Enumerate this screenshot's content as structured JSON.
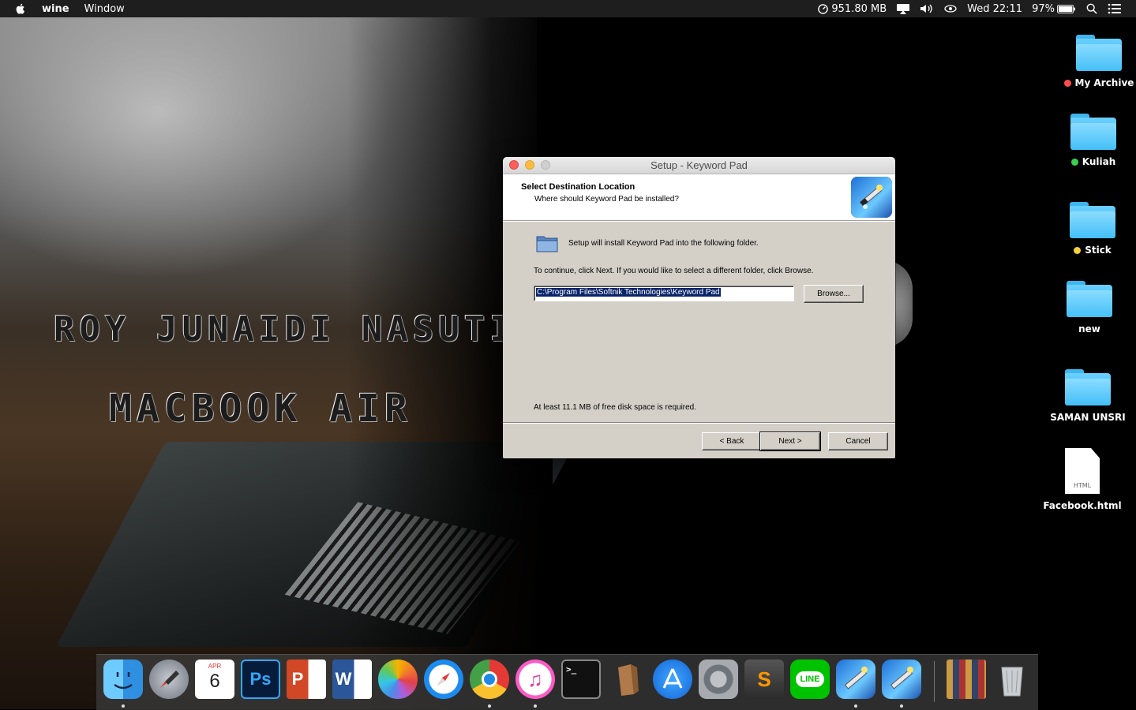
{
  "menubar": {
    "app_name": "wine",
    "menus": [
      "Window"
    ],
    "memory": "951.80 MB",
    "clock": "Wed 22:11",
    "battery": "97%"
  },
  "wallpaper": {
    "line1": "Roy Junaidi Nasution",
    "line2": "MacBook Air"
  },
  "desktop_icons": [
    {
      "label": "My Archive",
      "tag_color": "#ff4d4d"
    },
    {
      "label": "Kuliah",
      "tag_color": "#3ccf4e"
    },
    {
      "label": "Stick",
      "tag_color": "#f4d03f"
    },
    {
      "label": "new",
      "tag_color": ""
    },
    {
      "label": "SAMAN UNSRI",
      "tag_color": ""
    },
    {
      "label": "Facebook.html",
      "file_badge": "HTML"
    }
  ],
  "setup": {
    "window_title": "Setup - Keyword Pad",
    "header_title": "Select Destination Location",
    "header_subtitle": "Where should Keyword Pad be installed?",
    "intro_text": "Setup will install Keyword Pad into the following folder.",
    "continue_text": "To continue, click Next. If you would like to select a different folder, click Browse.",
    "path_value": "C:\\Program Files\\Softnik Technologies\\Keyword Pad",
    "browse_label": "Browse...",
    "disk_space_text": "At least 11.1 MB of free disk space is required.",
    "back_label": "< Back",
    "next_label": "Next >",
    "cancel_label": "Cancel"
  },
  "dock": {
    "calendar_month": "APR",
    "calendar_day": "6",
    "apps": [
      "Finder",
      "Launchpad",
      "Calendar",
      "Photoshop",
      "PowerPoint",
      "Word",
      "Photos",
      "Safari",
      "Chrome",
      "iTunes",
      "Terminal",
      "Archive Utility",
      "App Store",
      "System Preferences",
      "Sublime Text",
      "LINE",
      "Keyword Pad Setup",
      "Keyword Pad Setup",
      "Downloads",
      "Trash"
    ]
  }
}
